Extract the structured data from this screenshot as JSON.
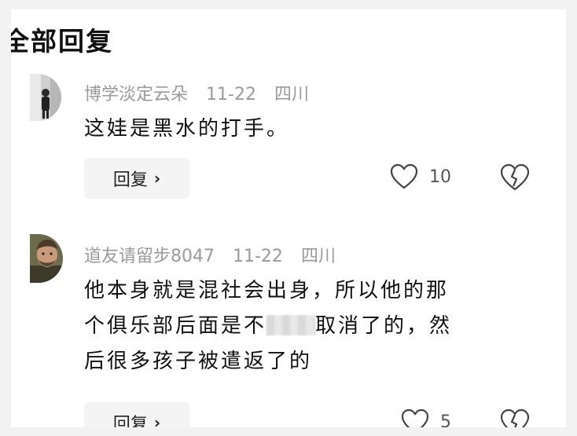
{
  "header": {
    "title": "全部回复"
  },
  "comments": [
    {
      "username": "博学淡定云朵",
      "date": "11-22",
      "location": "四川",
      "lines": [
        "这娃是黑水的打手。"
      ],
      "reply_label": "回复",
      "like_count": "10"
    },
    {
      "username": "道友请留步8047",
      "date": "11-22",
      "location": "四川",
      "line1": "他本身就是混社会出身，所以他的那",
      "line2_before": "个俱乐部后面是不",
      "line2_after": "取消了的，然",
      "line3": "后很多孩子被遣返了的",
      "reply_label": "回复",
      "like_count": "5"
    }
  ],
  "icons": {
    "reply_chevron": "chevron-right-icon",
    "like": "heart-outline-icon",
    "dislike": "broken-heart-icon"
  }
}
